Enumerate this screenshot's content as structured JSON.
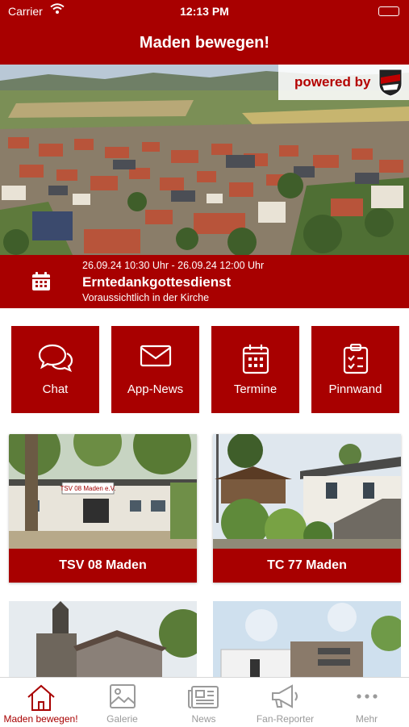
{
  "status_bar": {
    "carrier": "Carrier",
    "time": "12:13 PM"
  },
  "header": {
    "title": "Maden bewegen!"
  },
  "hero": {
    "badge_text": "powered by",
    "badge_logo": "TSV 08 Maden"
  },
  "event": {
    "datetime": "26.09.24 10:30 Uhr - 26.09.24 12:00 Uhr",
    "title": "Erntedankgottesdienst",
    "location": "Voraussichtlich in der Kirche"
  },
  "tiles": [
    {
      "label": "Chat",
      "icon": "chat-icon"
    },
    {
      "label": "App-News",
      "icon": "envelope-icon"
    },
    {
      "label": "Termine",
      "icon": "calendar-icon"
    },
    {
      "label": "Pinnwand",
      "icon": "clipboard-icon"
    }
  ],
  "cards": [
    {
      "label": "TSV 08 Maden",
      "sign": "TSV 08 Maden e.V."
    },
    {
      "label": "TC 77 Maden"
    }
  ],
  "tabs": [
    {
      "label": "Maden bewegen!",
      "icon": "home-icon",
      "active": true
    },
    {
      "label": "Galerie",
      "icon": "image-icon"
    },
    {
      "label": "News",
      "icon": "newspaper-icon"
    },
    {
      "label": "Fan-Reporter",
      "icon": "megaphone-icon"
    },
    {
      "label": "Mehr",
      "icon": "more-icon"
    }
  ],
  "colors": {
    "accent": "#a80000",
    "inactive_tab": "#9a9a9a"
  }
}
